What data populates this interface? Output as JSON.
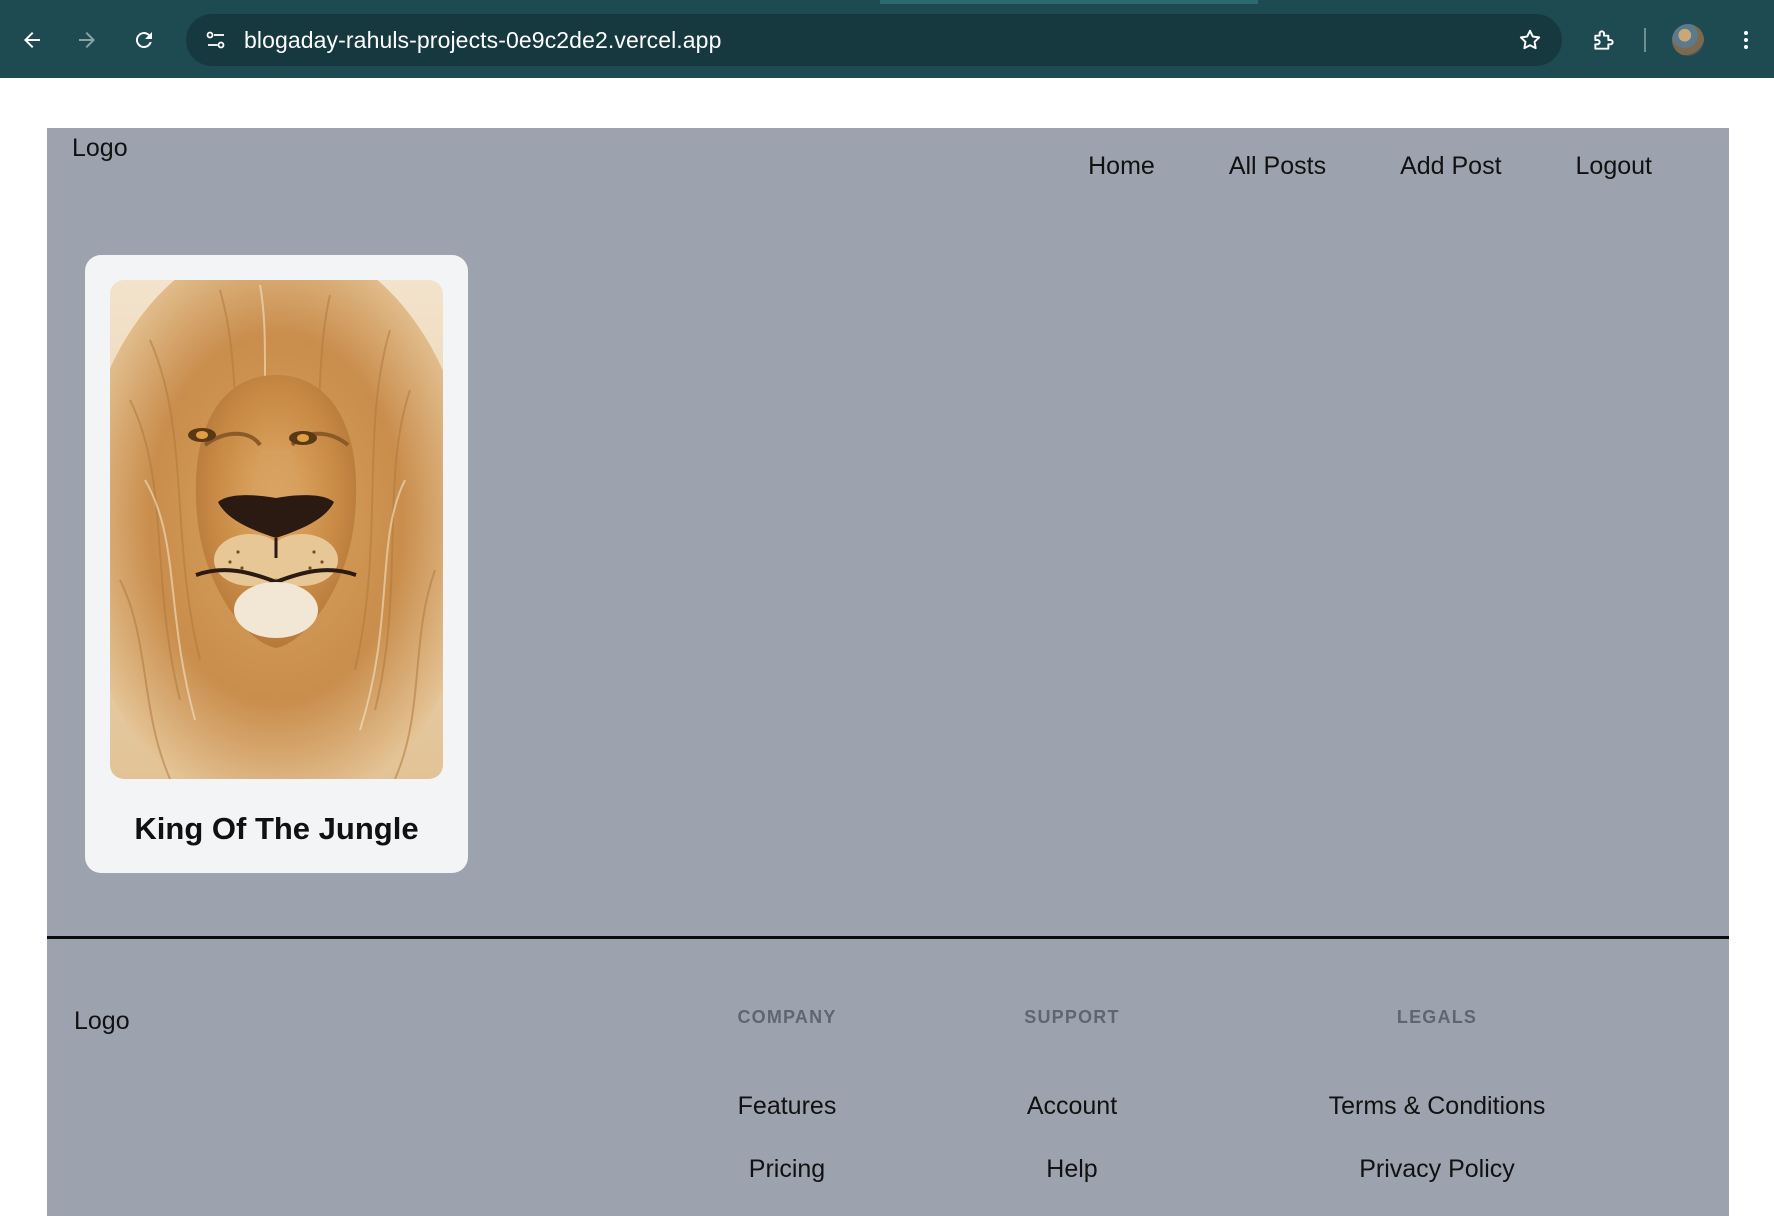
{
  "browser": {
    "url": "blogaday-rahuls-projects-0e9c2de2.vercel.app",
    "icons": [
      "back-arrow-icon",
      "forward-arrow-icon",
      "reload-icon",
      "site-info-icon",
      "bookmark-star-icon",
      "extensions-icon",
      "profile-avatar",
      "more-menu-icon"
    ]
  },
  "header": {
    "logo": "Logo",
    "nav": [
      "Home",
      "All Posts",
      "Add Post",
      "Logout"
    ]
  },
  "posts": [
    {
      "title": "King Of The Jungle",
      "image": "lion-portrait"
    }
  ],
  "footer": {
    "logo": "Logo",
    "columns": [
      {
        "heading": "COMPANY",
        "links": [
          "Features",
          "Pricing"
        ]
      },
      {
        "heading": "SUPPORT",
        "links": [
          "Account",
          "Help"
        ]
      },
      {
        "heading": "LEGALS",
        "links": [
          "Terms & Conditions",
          "Privacy Policy"
        ]
      }
    ]
  },
  "colors": {
    "chrome": "#1e4a52",
    "page_bg": "#9ca3af",
    "card_bg": "#f3f4f6"
  }
}
